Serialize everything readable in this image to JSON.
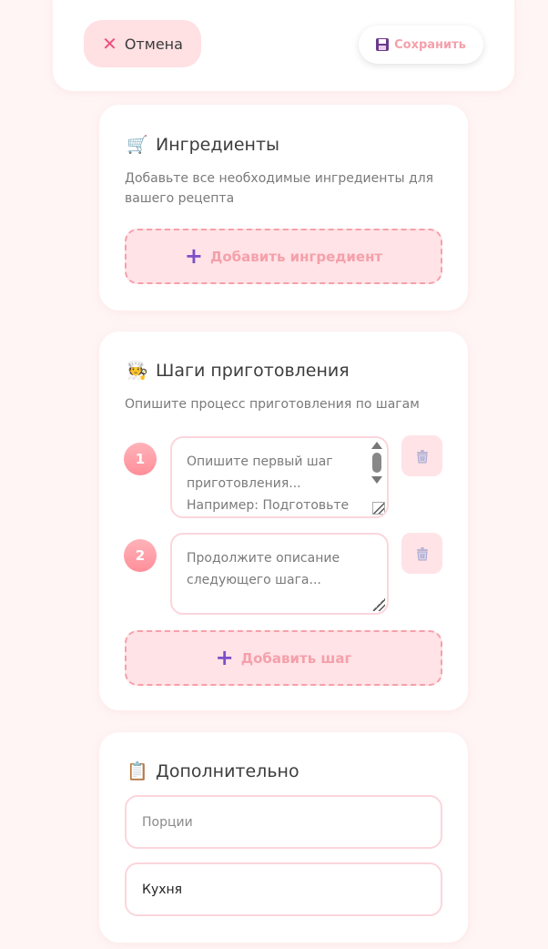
{
  "header": {
    "cancel_label": "Отмена",
    "save_label": "Сохранить"
  },
  "ingredients": {
    "title": "Ингредиенты",
    "emoji": "🛒",
    "description": "Добавьте все необходимые ингредиенты для вашего рецепта",
    "add_label": "Добавить ингредиент"
  },
  "steps": {
    "title": "Шаги приготовления",
    "emoji": "🧑‍🍳",
    "description": "Опишите процесс приготовления по шагам",
    "items": [
      {
        "number": "1",
        "placeholder": "Опишите первый шаг приготовления... Например: Подготовьте"
      },
      {
        "number": "2",
        "placeholder": "Продолжите описание следующего шага..."
      }
    ],
    "add_label": "Добавить шаг"
  },
  "extra": {
    "title": "Дополнительно",
    "emoji": "📋",
    "servings_placeholder": "Порции",
    "cuisine_value": "Кухня"
  },
  "colors": {
    "accent_pink": "#f5a0ab",
    "plus_purple": "#7b4fc9",
    "cancel_x": "#ef4f7b"
  }
}
